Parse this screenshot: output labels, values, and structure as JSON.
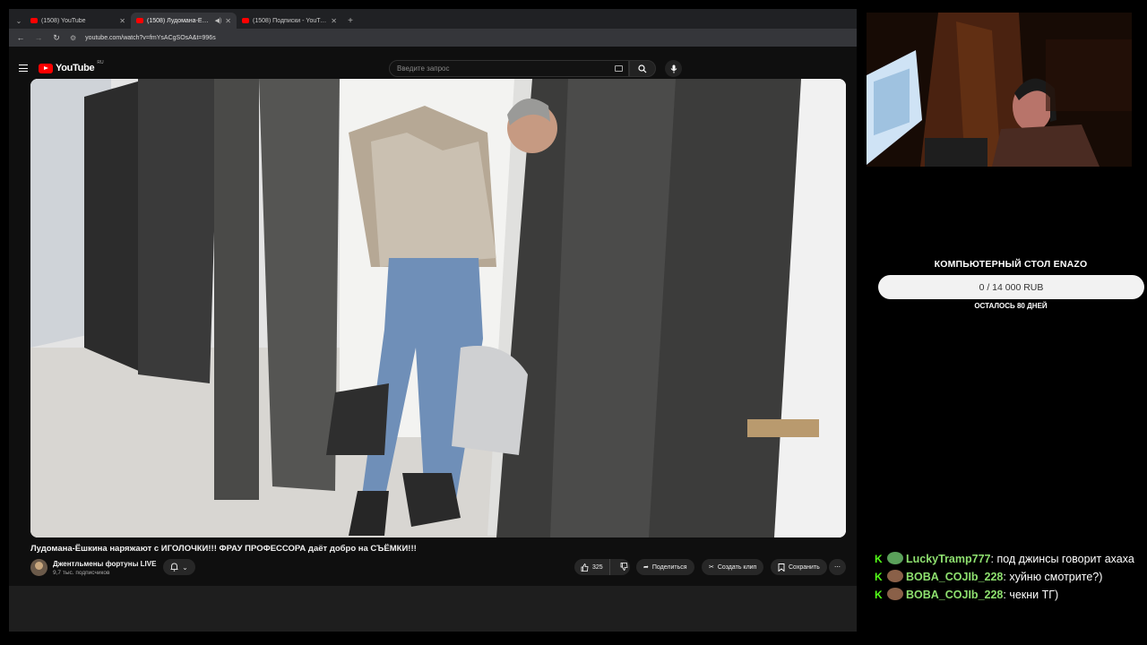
{
  "browser": {
    "tabs": [
      {
        "title": "(1508) YouTube",
        "active": false,
        "audio": false
      },
      {
        "title": "(1508) Лудомана-Ёшкина",
        "active": true,
        "audio": true
      },
      {
        "title": "(1508) Подписки - YouTube",
        "active": false,
        "audio": false
      }
    ],
    "url": "youtube.com/watch?v=fmYsACgSOsA&t=996s"
  },
  "youtube": {
    "logo_text": "YouTube",
    "region": "RU",
    "search_placeholder": "Введите запрос",
    "video": {
      "title": "Лудомана-Ёшкина наряжают с ИГОЛОЧКИ!!! ФРАУ ПРОФЕССОРА даёт добро на СЪЁМКИ!!!",
      "channel": "Джентльмены фортуны LIVE",
      "subscribers": "9,7 тыс. подписчиков",
      "likes": "325",
      "share_label": "Поделиться",
      "clip_label": "Создать клип",
      "save_label": "Сохранить"
    }
  },
  "stream": {
    "goal": {
      "title": "КОМПЬЮТЕРНЫЙ СТОЛ ENAZO",
      "progress": "0 / 14 000 RUB",
      "progress_fraction": 0,
      "remaining": "ОСТАЛОСЬ 80 ДНЕЙ"
    },
    "chat": [
      {
        "user": "LuckyTramp777",
        "text": "под джинсы говорит ахаха"
      },
      {
        "user": "BOBA_COJIb_228",
        "text": "хуйню смотрите?)"
      },
      {
        "user": "BOBA_COJIb_228",
        "text": "чекни ТГ)"
      }
    ],
    "platform_badge": "K"
  },
  "colors": {
    "yt_red": "#ff0000",
    "kick_green": "#53fc18",
    "username_green": "#8ee06f"
  }
}
